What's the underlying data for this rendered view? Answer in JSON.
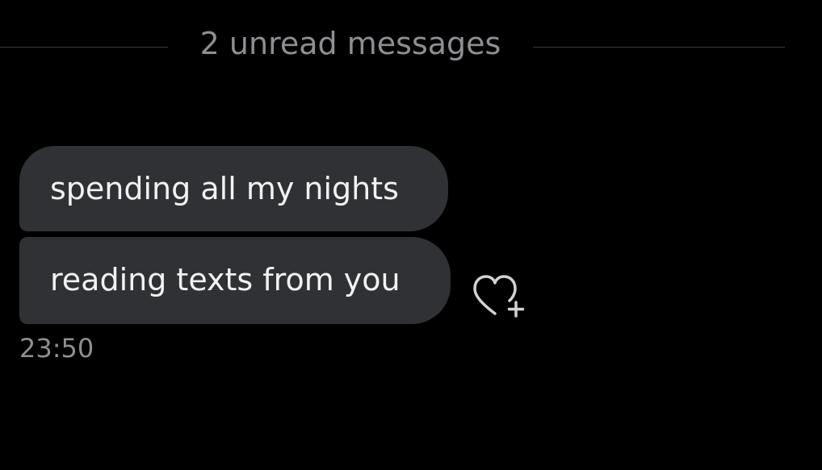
{
  "divider": {
    "text": "2 unread messages"
  },
  "messages": [
    {
      "text": "spending all my nights"
    },
    {
      "text": "reading texts from you"
    }
  ],
  "timestamp": "23:50",
  "icons": {
    "react": "heart-plus-icon"
  },
  "colors": {
    "background": "#000000",
    "bubble": "#303135",
    "bubble_text": "#f2f2f2",
    "muted_text": "#8e8e93",
    "divider_line": "#3a3a3c"
  }
}
